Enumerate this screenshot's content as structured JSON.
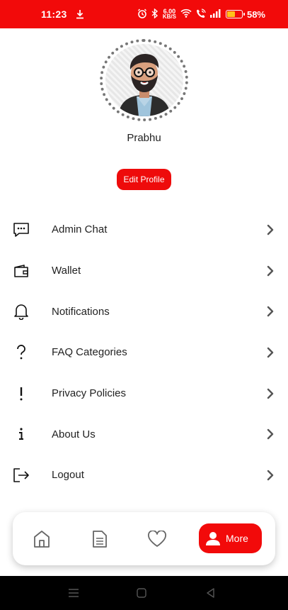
{
  "status_bar": {
    "time": "11:23",
    "net_speed_value": "6.00",
    "net_speed_unit": "KB/S",
    "battery_percent": "58%",
    "battery_level": 0.58,
    "color": "#f20a0a"
  },
  "profile": {
    "name": "Prabhu",
    "edit_label": "Edit Profile",
    "avatar_icon": "bearded-man-avatar"
  },
  "menu": {
    "items": [
      {
        "label": "Admin Chat",
        "icon": "chat-icon"
      },
      {
        "label": "Wallet",
        "icon": "wallet-icon"
      },
      {
        "label": "Notifications",
        "icon": "bell-icon"
      },
      {
        "label": "FAQ Categories",
        "icon": "question-icon"
      },
      {
        "label": "Privacy Policies",
        "icon": "exclamation-icon"
      },
      {
        "label": "About Us",
        "icon": "info-icon"
      },
      {
        "label": "Logout",
        "icon": "logout-icon"
      }
    ]
  },
  "bottom_nav": {
    "items": [
      {
        "icon": "home-icon"
      },
      {
        "icon": "document-icon"
      },
      {
        "icon": "heart-icon"
      }
    ],
    "active_label": "More",
    "active_icon": "person-icon",
    "accent": "#f20a0a"
  }
}
